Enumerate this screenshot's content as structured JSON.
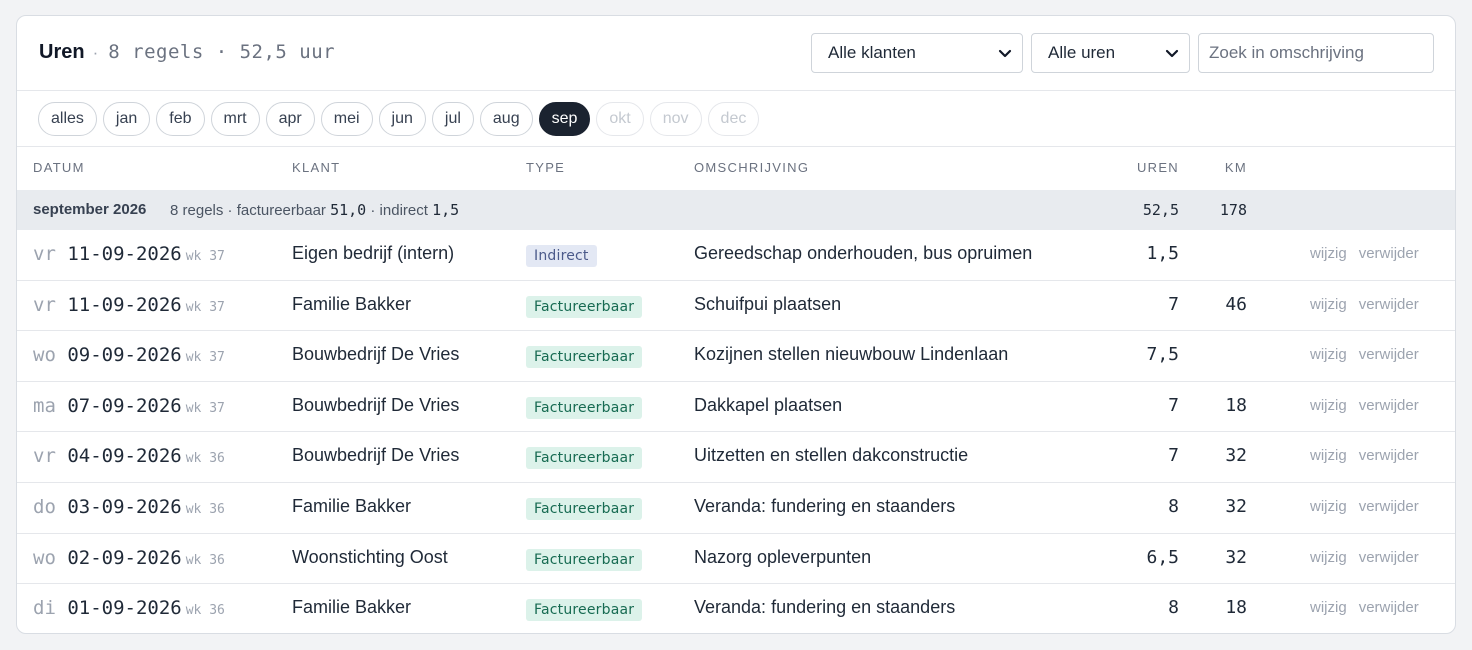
{
  "header": {
    "title": "Uren",
    "separator": "·",
    "meta": "8 regels · 52,5 uur",
    "klant_select": "Alle klanten",
    "uren_select": "Alle uren",
    "search_placeholder": "Zoek in omschrijving"
  },
  "months": [
    {
      "label": "alles",
      "state": "normal"
    },
    {
      "label": "jan",
      "state": "normal"
    },
    {
      "label": "feb",
      "state": "normal"
    },
    {
      "label": "mrt",
      "state": "normal"
    },
    {
      "label": "apr",
      "state": "normal"
    },
    {
      "label": "mei",
      "state": "normal"
    },
    {
      "label": "jun",
      "state": "normal"
    },
    {
      "label": "jul",
      "state": "normal"
    },
    {
      "label": "aug",
      "state": "normal"
    },
    {
      "label": "sep",
      "state": "active"
    },
    {
      "label": "okt",
      "state": "disabled"
    },
    {
      "label": "nov",
      "state": "disabled"
    },
    {
      "label": "dec",
      "state": "disabled"
    }
  ],
  "columns": {
    "datum": "DATUM",
    "klant": "KLANT",
    "type": "TYPE",
    "omschrijving": "OMSCHRIJVING",
    "uren": "UREN",
    "km": "KM"
  },
  "group": {
    "title": "september 2026",
    "info_prefix": "8 regels · factureerbaar",
    "factureerbaar": "51,0",
    "info_mid": "· indirect",
    "indirect": "1,5",
    "uren": "52,5",
    "km": "178"
  },
  "actions": {
    "edit": "wijzig",
    "delete": "verwijder"
  },
  "rows": [
    {
      "dow": "vr",
      "date": "11-09-2026",
      "wk": "wk 37",
      "klant": "Eigen bedrijf (intern)",
      "type": "Indirect",
      "type_key": "indirect",
      "oms": "Gereedschap onderhouden, bus opruimen",
      "uren": "1,5",
      "km": ""
    },
    {
      "dow": "vr",
      "date": "11-09-2026",
      "wk": "wk 37",
      "klant": "Familie Bakker",
      "type": "Factureerbaar",
      "type_key": "factureerbaar",
      "oms": "Schuifpui plaatsen",
      "uren": "7",
      "km": "46"
    },
    {
      "dow": "wo",
      "date": "09-09-2026",
      "wk": "wk 37",
      "klant": "Bouwbedrijf De Vries",
      "type": "Factureerbaar",
      "type_key": "factureerbaar",
      "oms": "Kozijnen stellen nieuwbouw Lindenlaan",
      "uren": "7,5",
      "km": ""
    },
    {
      "dow": "ma",
      "date": "07-09-2026",
      "wk": "wk 37",
      "klant": "Bouwbedrijf De Vries",
      "type": "Factureerbaar",
      "type_key": "factureerbaar",
      "oms": "Dakkapel plaatsen",
      "uren": "7",
      "km": "18"
    },
    {
      "dow": "vr",
      "date": "04-09-2026",
      "wk": "wk 36",
      "klant": "Bouwbedrijf De Vries",
      "type": "Factureerbaar",
      "type_key": "factureerbaar",
      "oms": "Uitzetten en stellen dakconstructie",
      "uren": "7",
      "km": "32"
    },
    {
      "dow": "do",
      "date": "03-09-2026",
      "wk": "wk 36",
      "klant": "Familie Bakker",
      "type": "Factureerbaar",
      "type_key": "factureerbaar",
      "oms": "Veranda: fundering en staanders",
      "uren": "8",
      "km": "32"
    },
    {
      "dow": "wo",
      "date": "02-09-2026",
      "wk": "wk 36",
      "klant": "Woonstichting Oost",
      "type": "Factureerbaar",
      "type_key": "factureerbaar",
      "oms": "Nazorg opleverpunten",
      "uren": "6,5",
      "km": "32"
    },
    {
      "dow": "di",
      "date": "01-09-2026",
      "wk": "wk 36",
      "klant": "Familie Bakker",
      "type": "Factureerbaar",
      "type_key": "factureerbaar",
      "oms": "Veranda: fundering en staanders",
      "uren": "8",
      "km": "18"
    }
  ],
  "icons": {
    "select_chevron": "chevron-down-icon"
  },
  "colors": {
    "active_pill": "#1b2330",
    "factureerbaar_bg": "#dcf2ea",
    "indirect_bg": "#e3e8f4",
    "group_bg": "#e8ebef"
  }
}
